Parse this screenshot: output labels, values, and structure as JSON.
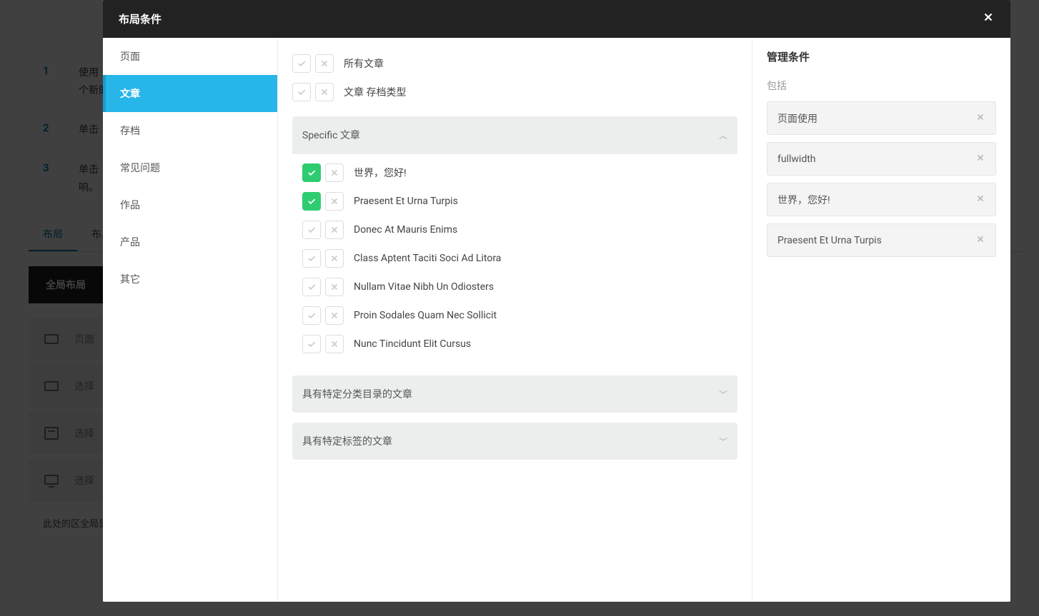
{
  "modal": {
    "title": "布局条件",
    "close_label": "×"
  },
  "sidebar": {
    "items": [
      {
        "label": "页面"
      },
      {
        "label": "文章"
      },
      {
        "label": "存档"
      },
      {
        "label": "常见问题"
      },
      {
        "label": "作品"
      },
      {
        "label": "产品"
      },
      {
        "label": "其它"
      }
    ]
  },
  "main": {
    "top_rows": [
      {
        "label": "所有文章"
      },
      {
        "label": "文章 存档类型"
      }
    ],
    "panels": [
      {
        "title": "Specific 文章",
        "open": true,
        "rows": [
          {
            "label": "世界，您好!",
            "on": true
          },
          {
            "label": "Praesent Et Urna Turpis",
            "on": true
          },
          {
            "label": "Donec At Mauris Enims",
            "on": false
          },
          {
            "label": "Class Aptent Taciti Soci Ad Litora",
            "on": false
          },
          {
            "label": "Nullam Vitae Nibh Un Odiosters",
            "on": false
          },
          {
            "label": "Proin Sodales Quam Nec Sollicit",
            "on": false
          },
          {
            "label": "Nunc Tincidunt Elit Cursus",
            "on": false
          }
        ]
      },
      {
        "title": "具有特定分类目录的文章",
        "open": false,
        "rows": []
      },
      {
        "title": "具有特定标签的文章",
        "open": false,
        "rows": []
      }
    ]
  },
  "right": {
    "title": "管理条件",
    "section": "包括",
    "items": [
      {
        "label": "页面使用"
      },
      {
        "label": "fullwidth"
      },
      {
        "label": "世界，您好!"
      },
      {
        "label": "Praesent Et Urna Turpis"
      }
    ]
  },
  "bg": {
    "steps": [
      {
        "num": "1",
        "text1": "使用",
        "text2": "个新的"
      },
      {
        "num": "2",
        "text1": "单击",
        "text2": ""
      },
      {
        "num": "3",
        "text1": "单击",
        "text2": "响。"
      }
    ],
    "tabs": [
      {
        "label": "布局",
        "active": true
      },
      {
        "label": "布局选",
        "active": false
      }
    ],
    "global": "全局布局",
    "items": [
      {
        "label": "页面"
      },
      {
        "label": "选择"
      },
      {
        "label": "选择"
      },
      {
        "label": "选择"
      }
    ],
    "footer_text": "此处的区全局显示",
    "dots": [
      {
        "label": "页面使用"
      },
      {
        "label": "fullwidth"
      }
    ]
  }
}
